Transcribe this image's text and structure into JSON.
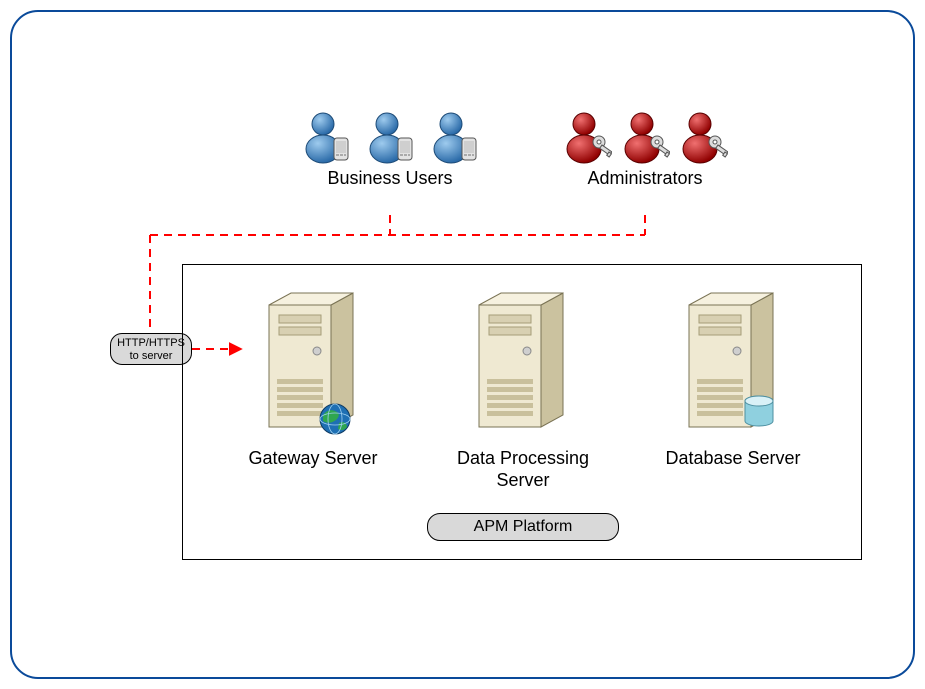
{
  "users": {
    "business_label": "Business Users",
    "admin_label": "Administrators"
  },
  "servers": {
    "gateway": "Gateway Server",
    "dataproc": "Data Processing Server",
    "database": "Database Server"
  },
  "platform_label": "APM Platform",
  "protocol": {
    "line1": "HTTP/HTTPS",
    "line2": "to server"
  },
  "icons": {
    "user_blue": "user-mobile-icon-blue",
    "user_red": "user-key-icon-red",
    "server": "server-tower-icon",
    "globe": "globe-icon",
    "db_cyl": "database-cylinder-icon"
  },
  "colors": {
    "frame": "#0a4a9a",
    "wire": "#ff0000",
    "pill_bg": "#d9d9d9",
    "user_blue_dark": "#2a6aa8",
    "user_blue_light": "#7fb4e0",
    "user_red_dark": "#900000",
    "user_red_light": "#d84040",
    "server_face": "#efe9d2",
    "server_side": "#cbc29f",
    "server_top": "#f6f1df",
    "globe_a": "#1e6fb3",
    "globe_b": "#2fa64f",
    "cyl_top": "#bfe6ef",
    "cyl_side": "#8fd0df"
  }
}
